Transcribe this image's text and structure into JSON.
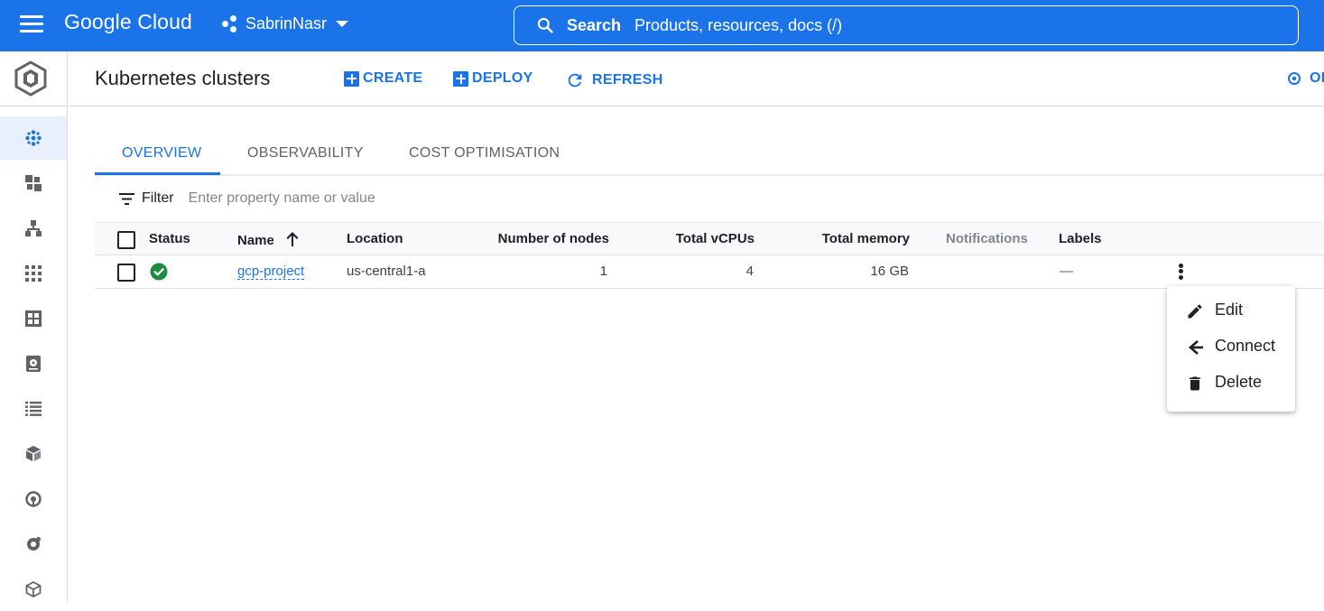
{
  "topbar": {
    "brand": "Google Cloud",
    "project": "SabrinNasr",
    "search_label": "Search",
    "search_placeholder": "Products, resources, docs (/)"
  },
  "leftnav": {
    "items": [
      {
        "icon": "clusters-icon",
        "active": true
      },
      {
        "icon": "workloads-icon"
      },
      {
        "icon": "services-ingress-icon"
      },
      {
        "icon": "applications-icon"
      },
      {
        "icon": "secrets-configmaps-icon"
      },
      {
        "icon": "storage-icon"
      },
      {
        "icon": "object-browser-icon"
      },
      {
        "icon": "migrate-to-containers-icon"
      },
      {
        "icon": "backup-icon"
      },
      {
        "icon": "config-icon"
      },
      {
        "icon": "marketplace-icon"
      }
    ]
  },
  "header": {
    "title": "Kubernetes clusters",
    "create": "CREATE",
    "deploy": "DEPLOY",
    "refresh": "REFRESH",
    "operations": "OP"
  },
  "tabs": [
    "OVERVIEW",
    "OBSERVABILITY",
    "COST OPTIMISATION"
  ],
  "filter": {
    "label": "Filter",
    "placeholder": "Enter property name or value"
  },
  "table": {
    "columns": [
      "Status",
      "Name",
      "Location",
      "Number of nodes",
      "Total vCPUs",
      "Total memory",
      "Notifications",
      "Labels"
    ],
    "rows": [
      {
        "status": "running",
        "name": "gcp-project",
        "location": "us-central1-a",
        "nodes": "1",
        "vcpus": "4",
        "memory": "16 GB",
        "notifications": "",
        "labels": "—"
      }
    ]
  },
  "row_menu": {
    "items": [
      "Edit",
      "Connect",
      "Delete"
    ],
    "highlighted": "Connect"
  },
  "colors": {
    "brand_blue": "#1a73e8",
    "status_green": "#1e8e3e",
    "highlight_yellow": "#f5f20c"
  }
}
